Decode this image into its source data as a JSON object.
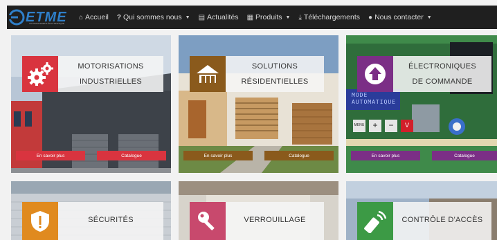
{
  "brand": {
    "name": "ETME",
    "tagline": "AUTOMATISMES & ÉLECTRONIQUE"
  },
  "nav": [
    {
      "label": "Accueil",
      "icon": "home-icon",
      "caret": false
    },
    {
      "label": "Qui sommes nous",
      "icon": "question-icon",
      "caret": true
    },
    {
      "label": "Actualités",
      "icon": "newspaper-icon",
      "caret": false
    },
    {
      "label": "Produits",
      "icon": "briefcase-icon",
      "caret": true
    },
    {
      "label": "Téléchargements",
      "icon": "download-icon",
      "caret": false
    },
    {
      "label": "Nous contacter",
      "icon": "chat-icon",
      "caret": true
    }
  ],
  "cards": [
    {
      "title1": "MOTORISATIONS",
      "title2": "INDUSTRIELLES",
      "icon": "gears-icon",
      "accent": "#d9343f",
      "buttons": [
        "En savoir plus",
        "Catalogue"
      ]
    },
    {
      "title1": "SOLUTIONS",
      "title2": "RÉSIDENTIELLES",
      "icon": "house-icon",
      "accent": "#8a5a1c",
      "buttons": [
        "En savoir plus",
        "Catalogue"
      ]
    },
    {
      "title1": "ÉLECTRONIQUES",
      "title2": "DE COMMANDE",
      "icon": "upload-icon",
      "accent": "#7b2f86",
      "buttons": [
        "En savoir plus",
        "Catalogue"
      ]
    },
    {
      "title1": "SÉCURITÉS",
      "icon": "shield-alert-icon",
      "accent": "#e08a1f"
    },
    {
      "title1": "VERROUILLAGE",
      "icon": "key-icon",
      "accent": "#c8496d"
    },
    {
      "title1": "CONTRÔLE D'ACCÈS",
      "icon": "remote-icon",
      "accent": "#3c9a45"
    }
  ],
  "panel_display": {
    "line1": "MODE",
    "line2": "AUTOMATIQUE"
  },
  "panel_keys": [
    "MENU",
    "+",
    "−",
    "V"
  ]
}
